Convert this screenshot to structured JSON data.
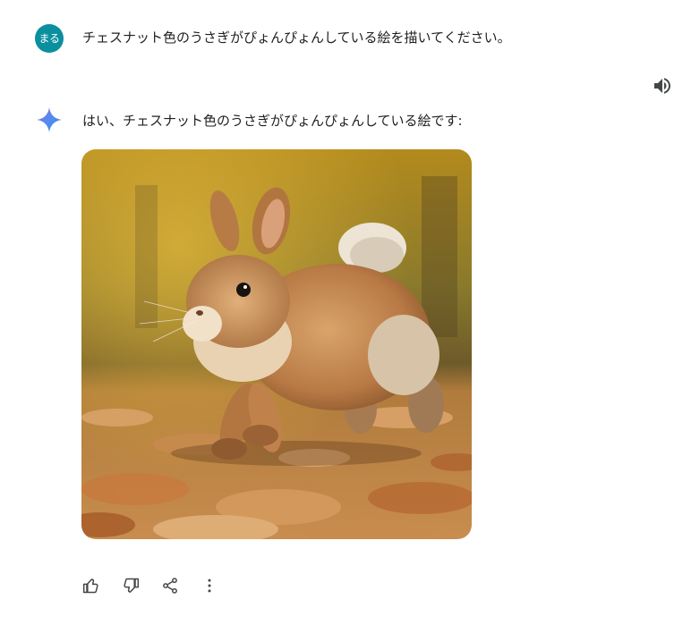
{
  "user": {
    "avatar_label": "まる",
    "message": "チェスナット色のうさぎがぴょんぴょんしている絵を描いてください。"
  },
  "assistant": {
    "reply": "はい、チェスナット色のうさぎがぴょんぴょんしている絵です:"
  },
  "icons": {
    "speaker": "speaker-icon",
    "assistant": "sparkle-icon",
    "thumbs_up": "thumbs-up-icon",
    "thumbs_down": "thumbs-down-icon",
    "share": "share-icon",
    "more": "more-vert-icon"
  },
  "colors": {
    "avatar_bg": "#0a8f9f",
    "text": "#1f1f1f",
    "icon": "#444746"
  }
}
